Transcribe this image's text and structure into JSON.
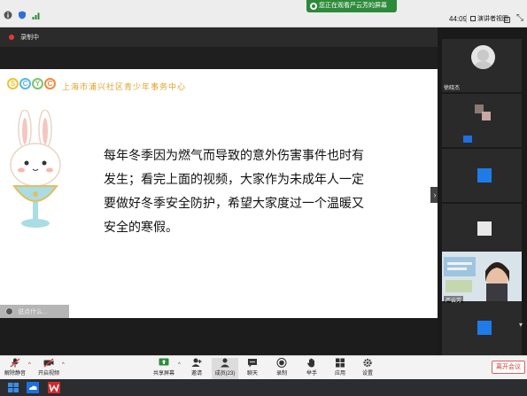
{
  "status_bar": {
    "sharing_banner": "您正在观看严云芳的屏幕",
    "timer": "44:09",
    "view_button": "演讲者视图"
  },
  "recording": {
    "label": "录制中"
  },
  "slide": {
    "org_logo_letters": [
      "S",
      "C",
      "Y",
      "C"
    ],
    "org_name": "上海市浦兴社区青少年事务中心",
    "main_text": "每年冬季因为燃气而导致的意外伤害事件也时有发生；看完上面的视频，大家作为未成年人一定要做好冬季安全防护，希望大家度过一个温暖又安全的寒假。",
    "chat_prompt": "说点什么..."
  },
  "participants": [
    {
      "name": "徐晓杰",
      "type": "avatar"
    },
    {
      "name": "",
      "type": "blocks",
      "blocks": [
        "#8a7a74",
        "#c9a7a2",
        "#1e6fe0"
      ]
    },
    {
      "name": "",
      "type": "blocks",
      "blocks": [
        "#1e7be8"
      ]
    },
    {
      "name": "严云芳",
      "type": "video"
    },
    {
      "name": "",
      "type": "blocks",
      "blocks": [
        "#e8e8e8"
      ]
    },
    {
      "name": "",
      "type": "blocks",
      "blocks": [
        "#1e7be8"
      ]
    }
  ],
  "toolbar": {
    "items": [
      {
        "label": "解除静音",
        "icon": "microphone-muted-icon"
      },
      {
        "label": "开启视频",
        "icon": "video-off-icon"
      },
      {
        "label": "共享屏幕",
        "icon": "share-screen-icon"
      },
      {
        "label": "邀请",
        "icon": "invite-icon"
      },
      {
        "label": "成员(23)",
        "icon": "members-icon"
      },
      {
        "label": "聊天",
        "icon": "chat-icon"
      },
      {
        "label": "录制",
        "icon": "record-icon"
      },
      {
        "label": "举手",
        "icon": "raise-hand-icon"
      },
      {
        "label": "应用",
        "icon": "apps-icon"
      },
      {
        "label": "设置",
        "icon": "settings-icon"
      }
    ],
    "leave_button": "离开会议"
  },
  "colors": {
    "accent_green": "#2d8a3a",
    "leave_red": "#d83b3b",
    "org_orange": "#e0a22a"
  }
}
